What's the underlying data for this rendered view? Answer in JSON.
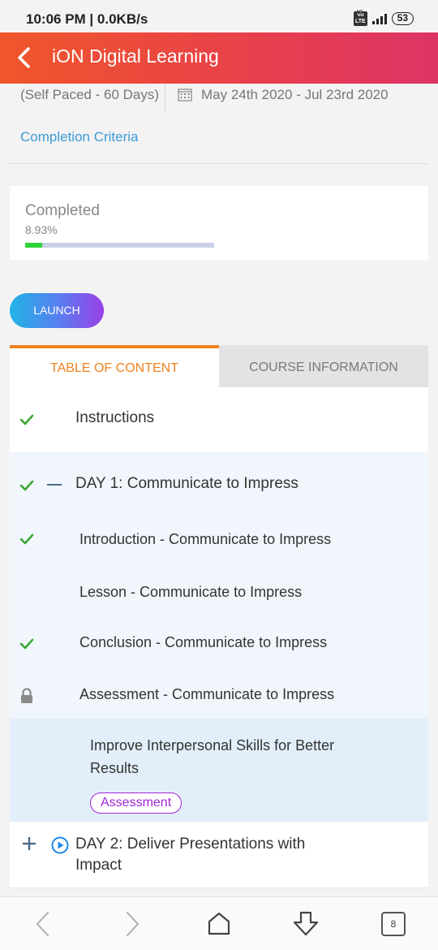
{
  "status_bar": {
    "time": "10:06 PM | 0.0KB/s",
    "volte": "Vo LTE",
    "network": "4G",
    "battery": "53"
  },
  "header": {
    "title": "iON Digital Learning",
    "back_icon": "chevron-left-icon"
  },
  "course": {
    "duration": "(Self Paced - 60 Days)",
    "dates": "May 24th 2020 - Jul 23rd 2020",
    "completion_criteria": "Completion Criteria"
  },
  "progress": {
    "label": "Completed",
    "percent_text": "8.93%",
    "percent": 8.93
  },
  "launch_button": "LAUNCH",
  "tabs": [
    {
      "label": "TABLE OF CONTENT",
      "active": true
    },
    {
      "label": "COURSE INFORMATION",
      "active": false
    }
  ],
  "toc": {
    "instructions": "Instructions",
    "day1_title": "DAY 1: Communicate to Impress",
    "day1_items": [
      "Introduction - Communicate to Impress",
      "Lesson - Communicate to Impress",
      "Conclusion - Communicate to Impress",
      "Assessment - Communicate to Impress"
    ],
    "selected_item_line1": "Improve Interpersonal Skills for Better",
    "selected_item_line2": "Results",
    "selected_badge": "Assessment",
    "day2_line1": "DAY 2: Deliver Presentations with",
    "day2_line2": "Impact"
  },
  "nav": {
    "tab_count": "8"
  },
  "colors": {
    "header_start": "#f0562a",
    "header_end": "#dd3466",
    "accent_orange": "#f08220",
    "link_blue": "#3b9ad6",
    "check_green": "#3aa832",
    "badge_purple": "#a028d8"
  }
}
